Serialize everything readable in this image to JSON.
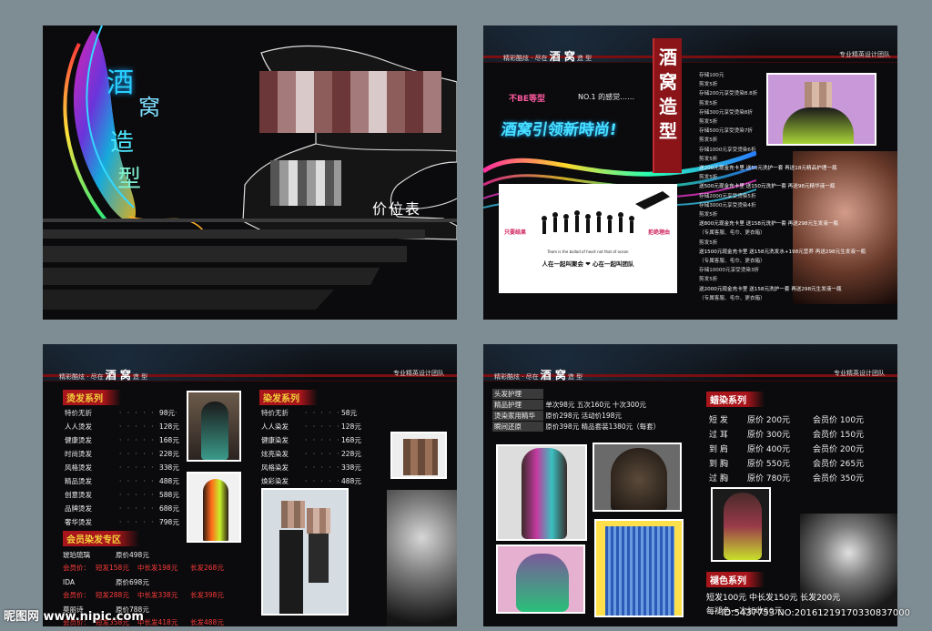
{
  "watermark": {
    "site_logo": "昵图网 www.nipic.com",
    "id_text": "ID:5437753 NO:20161219170330837000"
  },
  "header": {
    "tagline_pre": "精彩酷炫 · 尽在",
    "brand": "酒 窝",
    "tagline_post": "造 型",
    "team": "专业精英设计团队"
  },
  "cover": {
    "title_chars": [
      "酒",
      "窝",
      "造",
      "型"
    ],
    "subtitle": "价位表"
  },
  "p2": {
    "vertical_title": "酒窝造型",
    "slogan_small": "NO.1 的感觉……",
    "slogan_small_prefix": "不BE等型",
    "slogan_main": "酒窝引领新時尚!",
    "team_card": {
      "left": "只要结果",
      "right": "拒绝理由",
      "english": "Team is the ballad of heart not that of ocean",
      "bottom": "人在一起叫聚会 ❤ 心在一起叫团队"
    },
    "price_lines": [
      "存储100元",
      "剪发5折",
      "存储200元享受烫染8.8折",
      "剪发5折",
      "存储300元享受烫染8折",
      "剪发5折",
      "存储500元享受烫染7折",
      "剪发5折",
      "存储1000元享受烫染6折",
      "剪发5折",
      "送200元现金充卡里 送50元洗护一套 再送18元精品护理一瓶",
      "剪发5折",
      "送500元现金充卡里 送150元洗护一套 再送98元精华液一瓶",
      "存储2000元享受烫染5折",
      "存储3000元享受烫染4折",
      "剪发5折",
      "送800元现金充卡里 送158元洗护一套 再送298元生发液一瓶",
      "（专属客服、毛巾、更衣箱）",
      "剪发5折",
      "送1500元现金充卡里 送158元洗发水+198元营养 再送298元生发液一瓶",
      "（专属客服、毛巾、更衣箱）",
      "存储10000元享受烫染3折",
      "剪发5折",
      "送2000元现金充卡里 送158元洗护一套 再送298元生发液一瓶",
      "（专属客服、毛巾、更衣箱）"
    ]
  },
  "p3": {
    "perm": {
      "title": "烫发系列",
      "items": [
        {
          "name": "特价无折",
          "price": "98元"
        },
        {
          "name": "人人烫发",
          "price": "128元"
        },
        {
          "name": "健康烫发",
          "price": "168元"
        },
        {
          "name": "时尚烫发",
          "price": "228元"
        },
        {
          "name": "风格烫发",
          "price": "338元"
        },
        {
          "name": "精品烫发",
          "price": "488元"
        },
        {
          "name": "创意烫发",
          "price": "588元"
        },
        {
          "name": "品牌烫发",
          "price": "688元"
        },
        {
          "name": "奢华烫发",
          "price": "798元"
        }
      ]
    },
    "dye": {
      "title": "染发系列",
      "items": [
        {
          "name": "特价无折",
          "price": "58元"
        },
        {
          "name": "人人染发",
          "price": "128元"
        },
        {
          "name": "健康染发",
          "price": "168元"
        },
        {
          "name": "炫亮染发",
          "price": "228元"
        },
        {
          "name": "风格染发",
          "price": "338元"
        },
        {
          "name": "焕彩染发",
          "price": "488元"
        }
      ]
    },
    "member": {
      "title": "会员染发专区",
      "rows": [
        {
          "name": "琥珀琉璃",
          "orig": "原价498元",
          "member": "会员价：",
          "short": "短发158元",
          "mid": "中长发198元",
          "long": "长发268元"
        },
        {
          "name": "IDA",
          "orig": "原价698元",
          "member": "会员价：",
          "short": "短发288元",
          "mid": "中长发338元",
          "long": "长发398元"
        },
        {
          "name": "莫丽诗",
          "orig": "原价788元",
          "member": "会员价：",
          "short": "短发358元",
          "mid": "中长发418元",
          "long": "长发488元"
        }
      ]
    }
  },
  "p4": {
    "care": [
      {
        "name": "头发护理",
        "text": ""
      },
      {
        "name": "精品护理",
        "text": "单次98元    五次160元    十次300元"
      },
      {
        "name": "烫染家用精华",
        "text": "原价298元    活动价198元"
      },
      {
        "name": "瞬间还原",
        "text": "原价398元    精品套装1380元（每套）"
      }
    ],
    "wax": {
      "title": "蜡染系列",
      "rows": [
        {
          "len": "短 发",
          "orig": "原价 200元",
          "member": "会员价 100元"
        },
        {
          "len": "过 耳",
          "orig": "原价 300元",
          "member": "会员价 150元"
        },
        {
          "len": "到 肩",
          "orig": "原价 400元",
          "member": "会员价 200元"
        },
        {
          "len": "到 胸",
          "orig": "原价 550元",
          "member": "会员价 265元"
        },
        {
          "len": "过 胸",
          "orig": "原价 780元",
          "member": "会员价 350元"
        }
      ]
    },
    "fade": {
      "title": "褪色系列",
      "line1": "短发100元    中长发150元    长发200元",
      "line2": "每褪色一次加收50元"
    }
  }
}
